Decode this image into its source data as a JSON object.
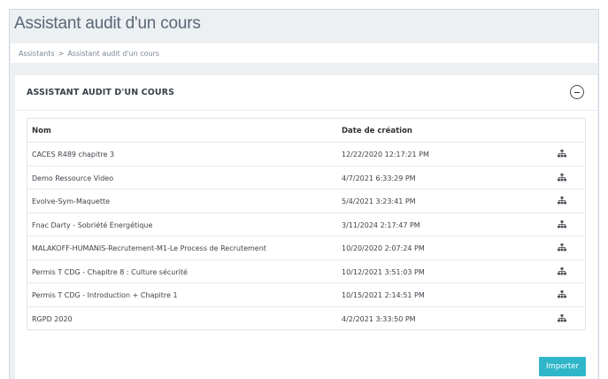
{
  "page": {
    "title": "Assistant audit d'un cours"
  },
  "breadcrumb": {
    "items": [
      "Assistants",
      "Assistant audit d'un cours"
    ],
    "separator": ">"
  },
  "panel": {
    "title": "ASSISTANT AUDIT D'UN COURS",
    "collapse_icon": "minus-circle-icon"
  },
  "table": {
    "columns": [
      "Nom",
      "Date de création"
    ],
    "action_icon": "sitemap-icon",
    "rows": [
      {
        "name": "CACES R489 chapitre 3",
        "date": "12/22/2020 12:17:21 PM"
      },
      {
        "name": "Demo Ressource Video",
        "date": "4/7/2021 6:33:29 PM"
      },
      {
        "name": "Evolve-Sym-Maquette",
        "date": "5/4/2021 3:23:41 PM"
      },
      {
        "name": "Fnac Darty - Sobriété Énergétique",
        "date": "3/11/2024 2:17:47 PM"
      },
      {
        "name": "MALAKOFF-HUMANIS-Recrutement-M1-Le Process de Recrutement",
        "date": "10/20/2020 2:07:24 PM"
      },
      {
        "name": "Permis T CDG - Chapitre 8 : Culture sécurité",
        "date": "10/12/2021 3:51:03 PM"
      },
      {
        "name": "Permis T CDG - Introduction + Chapitre 1",
        "date": "10/15/2021 2:14:51 PM"
      },
      {
        "name": "RGPD 2020",
        "date": "4/2/2021 3:33:50 PM"
      }
    ]
  },
  "actions": {
    "import_label": "Importer"
  },
  "colors": {
    "accent": "#2fb6c9",
    "background": "#edf0f3",
    "title_text": "#5b6776"
  }
}
